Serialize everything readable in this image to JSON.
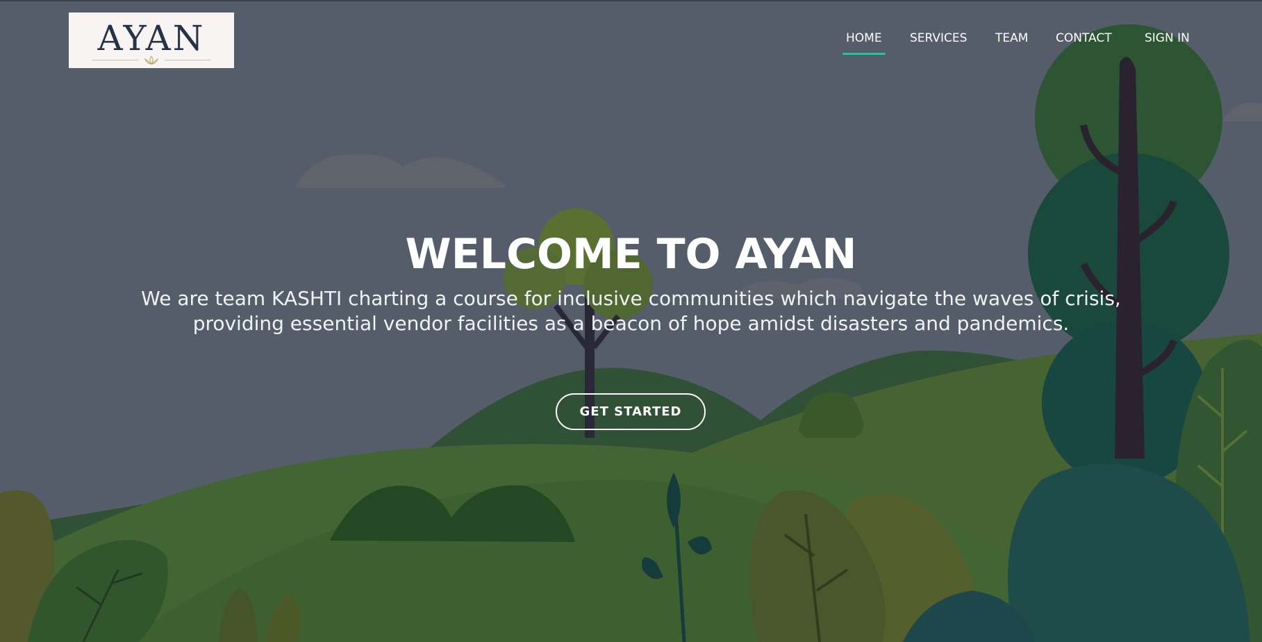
{
  "brand": {
    "logo_text": "AYAN",
    "accent_color": "#23c4a0"
  },
  "nav": {
    "items": [
      {
        "label": "HOME",
        "active": true
      },
      {
        "label": "SERVICES",
        "active": false
      },
      {
        "label": "TEAM",
        "active": false
      },
      {
        "label": "CONTACT",
        "active": false
      },
      {
        "label": "SIGN IN",
        "active": false
      }
    ]
  },
  "hero": {
    "title": "WELCOME TO AYAN",
    "subtitle_line1": "We are team KASHTI charting a course for inclusive communities which navigate the waves of crisis,",
    "subtitle_line2": "providing essential vendor facilities as a beacon of hope amidst disasters and pandemics.",
    "cta_label": "GET STARTED"
  }
}
